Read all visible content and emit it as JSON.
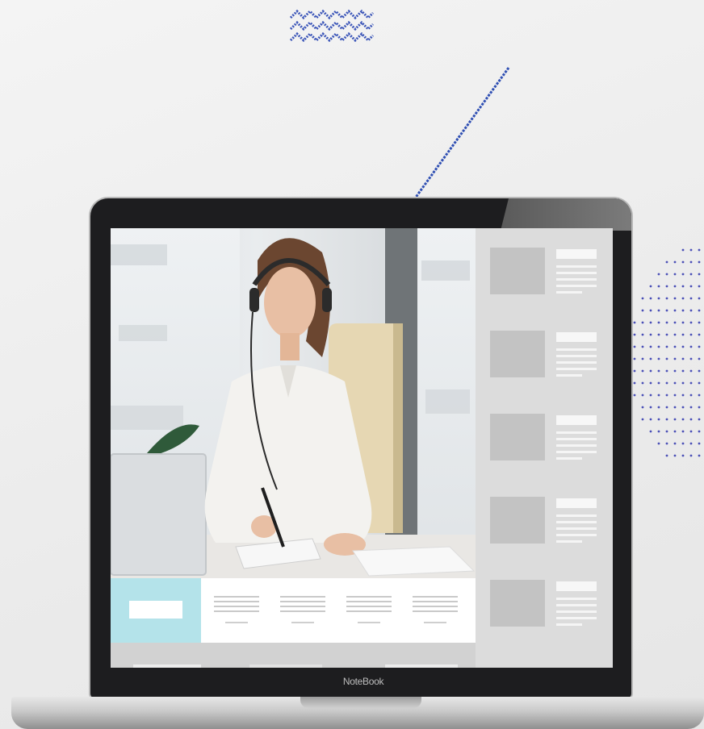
{
  "device": {
    "brand_label": "NoteBook"
  },
  "screen": {
    "video": {
      "scene": "woman-with-headset-taking-notes"
    },
    "sidebar": {
      "items": [
        {
          "thumb": "placeholder"
        },
        {
          "thumb": "placeholder"
        },
        {
          "thumb": "placeholder"
        },
        {
          "thumb": "placeholder"
        },
        {
          "thumb": "placeholder"
        }
      ]
    },
    "tabs": {
      "count": 5,
      "active_index": 0
    }
  },
  "colors": {
    "active_tab": "#b4e3ea",
    "accent_line": "#2f4fb3",
    "sidebar_bg": "#dcdcdc",
    "laptop_bezel": "#1d1d1f"
  },
  "icons": [
    "zigzag-decoration-icon",
    "diagonal-line-icon",
    "dot-grid-icon"
  ]
}
